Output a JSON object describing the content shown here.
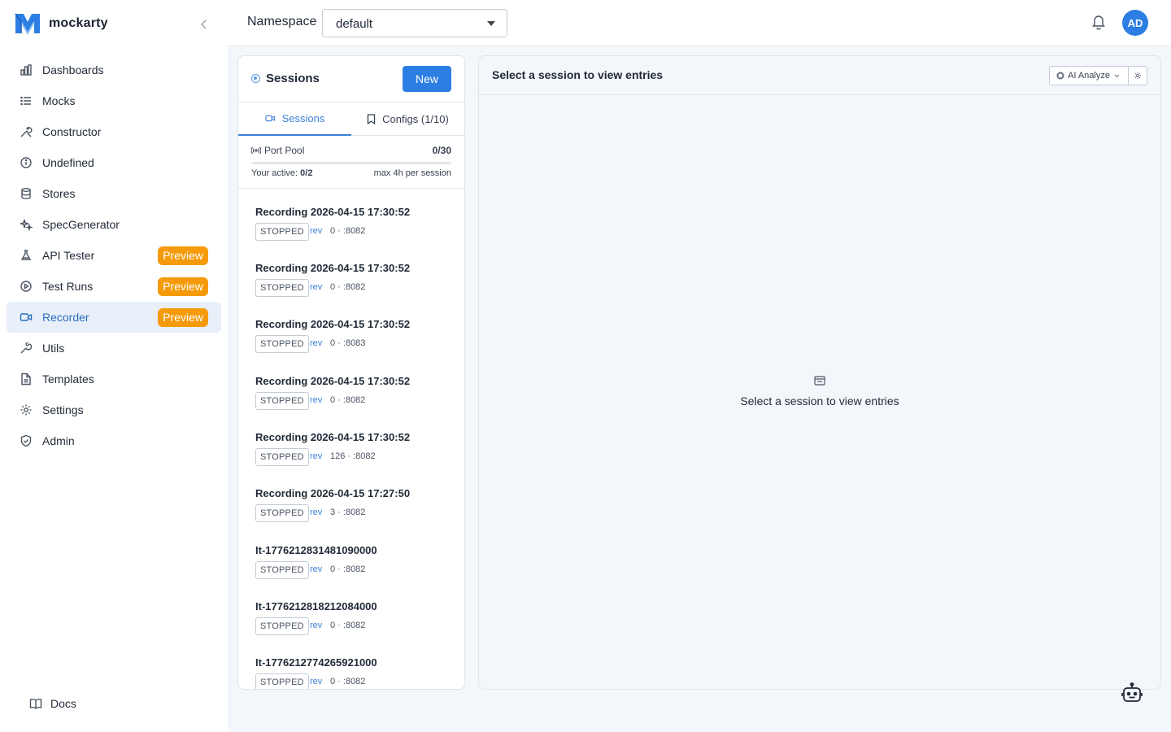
{
  "app": {
    "name": "mockarty",
    "brand_color": "#2d7ee3"
  },
  "sidebar": {
    "items": [
      {
        "label": "Dashboards",
        "icon": "bar-chart-icon"
      },
      {
        "label": "Mocks",
        "icon": "list-icon"
      },
      {
        "label": "Constructor",
        "icon": "tools-icon"
      },
      {
        "label": "Undefined",
        "icon": "info-icon"
      },
      {
        "label": "Stores",
        "icon": "database-icon"
      },
      {
        "label": "SpecGenerator",
        "icon": "sparkles-icon"
      },
      {
        "label": "API Tester",
        "icon": "flask-icon",
        "badge": "Preview"
      },
      {
        "label": "Test Runs",
        "icon": "play-circle-icon",
        "badge": "Preview"
      },
      {
        "label": "Recorder",
        "icon": "video-icon",
        "badge": "Preview",
        "active": true
      },
      {
        "label": "Utils",
        "icon": "wrench-icon"
      },
      {
        "label": "Templates",
        "icon": "file-icon"
      },
      {
        "label": "Settings",
        "icon": "gear-icon"
      },
      {
        "label": "Admin",
        "icon": "shield-icon"
      }
    ],
    "docs_label": "Docs"
  },
  "header": {
    "namespace_label": "Namespace",
    "namespace_value": "default",
    "avatar_initials": "AD"
  },
  "sessions_panel": {
    "title": "Sessions",
    "new_button": "New",
    "tabs": [
      {
        "label": "Sessions",
        "active": true
      },
      {
        "label": "Configs (1/10)",
        "active": false
      }
    ],
    "port_pool": {
      "label": "Port Pool",
      "count": "0/30",
      "fill_fraction": 0,
      "active_prefix": "Your active:",
      "active_value": "0/2",
      "max_text": "max 4h per session"
    },
    "sessions": [
      {
        "name": "Recording 2026-04-15 17:30:52",
        "status": "STOPPED",
        "rev": "rev",
        "meta": "0 · :8082"
      },
      {
        "name": "Recording 2026-04-15 17:30:52",
        "status": "STOPPED",
        "rev": "rev",
        "meta": "0 · :8082"
      },
      {
        "name": "Recording 2026-04-15 17:30:52",
        "status": "STOPPED",
        "rev": "rev",
        "meta": "0 · :8083"
      },
      {
        "name": "Recording 2026-04-15 17:30:52",
        "status": "STOPPED",
        "rev": "rev",
        "meta": "0 · :8082"
      },
      {
        "name": "Recording 2026-04-15 17:30:52",
        "status": "STOPPED",
        "rev": "rev",
        "meta": "126 · :8082"
      },
      {
        "name": "Recording 2026-04-15 17:27:50",
        "status": "STOPPED",
        "rev": "rev",
        "meta": "3 · :8082"
      },
      {
        "name": "It-1776212831481090000",
        "status": "STOPPED",
        "rev": "rev",
        "meta": "0 · :8082"
      },
      {
        "name": "It-1776212818212084000",
        "status": "STOPPED",
        "rev": "rev",
        "meta": "0 · :8082"
      },
      {
        "name": "It-1776212774265921000",
        "status": "STOPPED",
        "rev": "rev",
        "meta": "0 · :8082"
      }
    ]
  },
  "entries_panel": {
    "title": "Select a session to view entries",
    "ai_button": "AI Analyze",
    "empty_text": "Select a session to view entries"
  }
}
